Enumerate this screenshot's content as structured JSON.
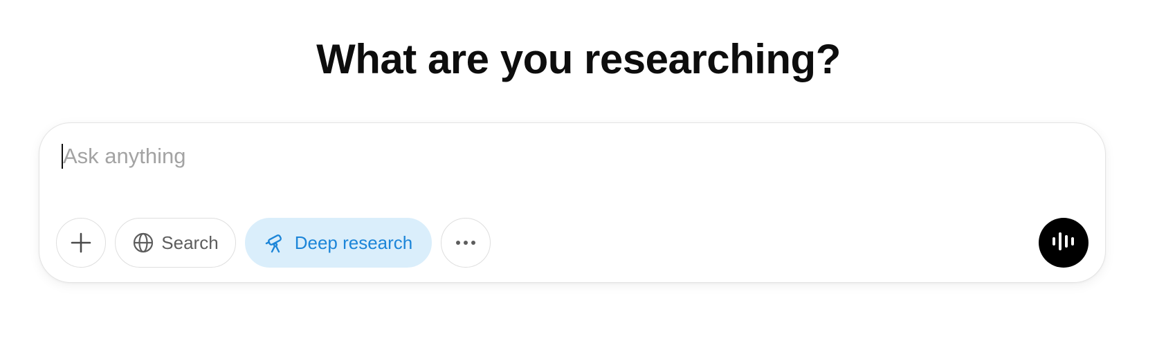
{
  "heading": "What are you researching?",
  "composer": {
    "placeholder": "Ask anything",
    "buttons": {
      "add_icon": "plus-icon",
      "search_label": "Search",
      "search_icon": "globe-icon",
      "deep_research_label": "Deep research",
      "deep_research_icon": "telescope-icon",
      "more_icon": "ellipsis-icon",
      "voice_icon": "waveform-icon"
    }
  },
  "colors": {
    "deep_research_bg": "#daeefb",
    "deep_research_text": "#1c85d8",
    "voice_button_bg": "#000000"
  }
}
